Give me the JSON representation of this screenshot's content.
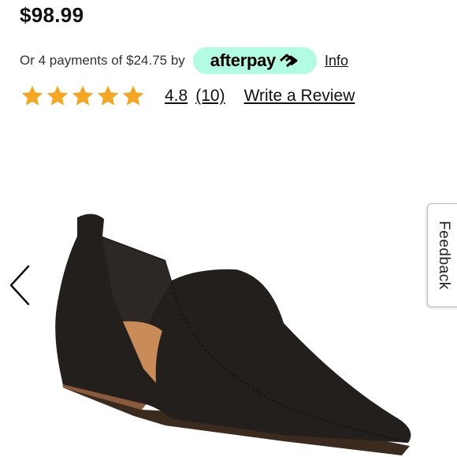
{
  "product": {
    "price": "$98.99"
  },
  "payments": {
    "text": "Or 4 payments of $24.75 by",
    "provider": "afterpay",
    "info_label": "Info"
  },
  "rating": {
    "stars": 5,
    "score": "4.8",
    "count": "(10)",
    "write_review_label": "Write a Review",
    "star_color": "#f5a623"
  },
  "gallery": {
    "image_icon": "shoe-image",
    "prev_icon": "chevron-left-icon"
  },
  "feedback": {
    "label": "Feedback"
  },
  "colors": {
    "afterpay_mint": "#b2fce4"
  }
}
